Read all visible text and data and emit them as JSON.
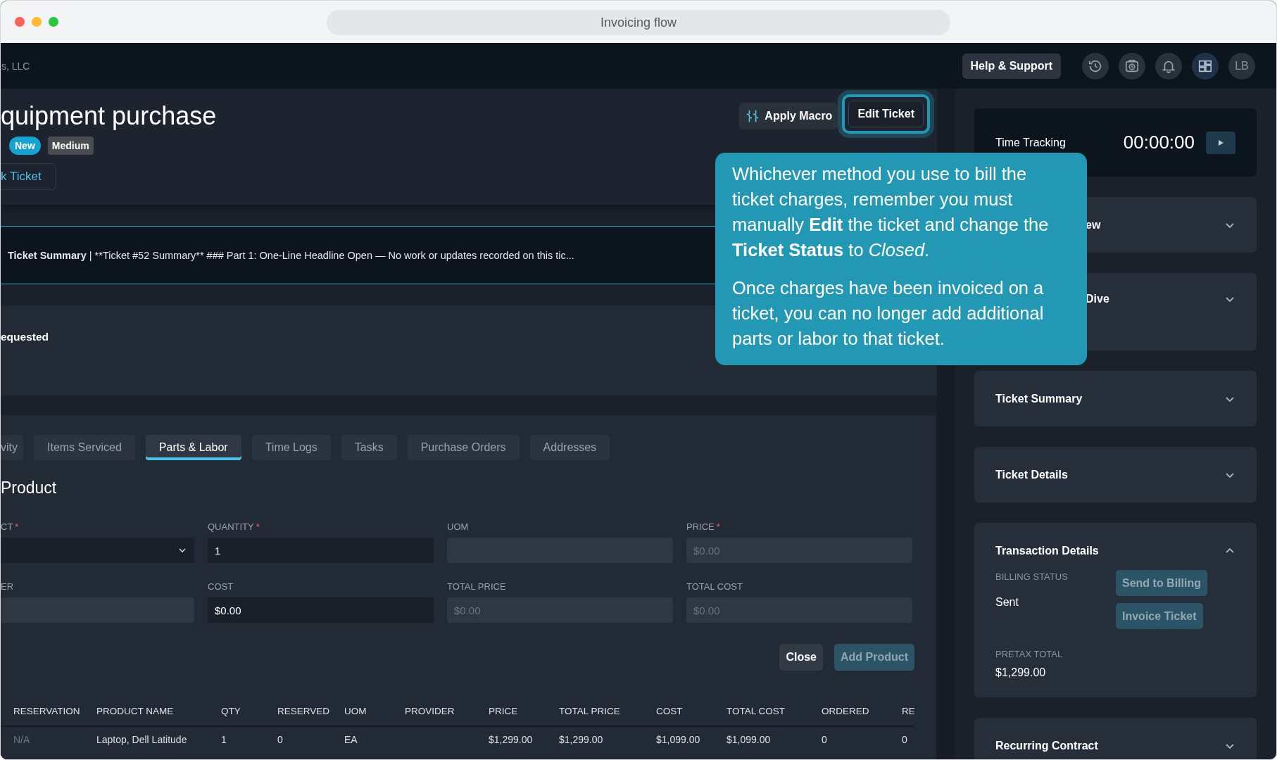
{
  "window": {
    "title": "Invoicing flow"
  },
  "nav": {
    "company": "s, LLC",
    "help_button": "Help & Support",
    "avatar": "LB"
  },
  "ticket": {
    "title": "quipment purchase",
    "badges": [
      {
        "label": "New",
        "kind": "status"
      },
      {
        "label": "Medium",
        "kind": "priority"
      }
    ],
    "link_button": "k Ticket",
    "actions": {
      "macro": "Apply Macro",
      "edit": "Edit Ticket"
    }
  },
  "summary": {
    "label": "Ticket Summary",
    "text": "| **Ticket #52 Summary** ### Part 1: One-Line Headline Open — No work or updates recorded on this tic..."
  },
  "requested": {
    "label": "equested"
  },
  "tabs": [
    {
      "label": "vity",
      "selected": false
    },
    {
      "label": "Items Serviced",
      "selected": false
    },
    {
      "label": "Parts & Labor",
      "selected": true
    },
    {
      "label": "Time Logs",
      "selected": false
    },
    {
      "label": "Tasks",
      "selected": false
    },
    {
      "label": "Purchase Orders",
      "selected": false
    },
    {
      "label": "Addresses",
      "selected": false
    }
  ],
  "product_form": {
    "heading": "Product",
    "fields": [
      {
        "label": "CT",
        "mark": "*",
        "kind": "select"
      },
      {
        "label": "QUANTITY",
        "mark": "*",
        "kind": "input",
        "value": "1"
      },
      {
        "label": "UOM",
        "kind": "disabled"
      },
      {
        "label": "PRICE",
        "mark": "*",
        "kind": "disabled",
        "placeholder": "$0.00"
      },
      {
        "label": "ER",
        "kind": "disabled"
      },
      {
        "label": "COST",
        "kind": "input",
        "value": "$0.00"
      },
      {
        "label": "TOTAL PRICE",
        "kind": "disabled",
        "placeholder": "$0.00"
      },
      {
        "label": "TOTAL COST",
        "kind": "disabled",
        "placeholder": "$0.00"
      }
    ],
    "buttons": [
      {
        "label": "Close",
        "kind": "secondary"
      },
      {
        "label": "Add Product",
        "kind": "primary"
      }
    ]
  },
  "table": {
    "columns": [
      "RESERVATION",
      "PRODUCT NAME",
      "QTY",
      "RESERVED",
      "UOM",
      "PROVIDER",
      "PRICE",
      "TOTAL PRICE",
      "COST",
      "TOTAL COST",
      "ORDERED",
      "RE"
    ],
    "rows": [
      [
        "N/A",
        "Laptop, Dell Latitude",
        "1",
        "0",
        "EA",
        null,
        "$1,299.00",
        "$1,299.00",
        "$1,099.00",
        "$1,099.00",
        "0",
        "0"
      ]
    ]
  },
  "tooltip": {
    "paragraphs": [
      "Whichever method you use to bill the ticket charges, remember you must manually **Edit** the ticket and change the **Ticket Status** to *Closed*.",
      "Once charges have been invoiced on a ticket, you can no longer add additional parts or labor to that ticket."
    ]
  },
  "sidebar": {
    "time_tracking": {
      "label": "Time Tracking",
      "time": "00:00:00"
    },
    "cards": [
      {
        "title": "ew",
        "expanded": false
      },
      {
        "title": "Dive",
        "expanded": false
      },
      {
        "title": "Ticket Summary",
        "expanded": false
      },
      {
        "title": "Ticket Details",
        "expanded": false
      },
      {
        "title": "Transaction Details",
        "expanded": true,
        "billing_label": "BILLING STATUS",
        "billing_value": "Sent",
        "buttons": [
          "Send to Billing",
          "Invoice Ticket"
        ],
        "total_label": "PRETAX TOTAL",
        "total_value": "$1,299.00"
      },
      {
        "title": "Recurring Contract",
        "expanded": false
      }
    ]
  }
}
